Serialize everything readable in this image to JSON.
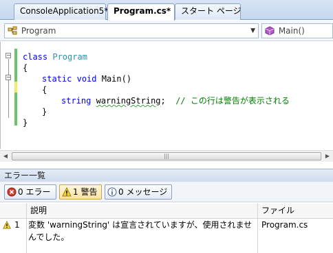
{
  "tabs": [
    {
      "label": "ConsoleApplication5*"
    },
    {
      "label": "Program.cs*"
    },
    {
      "label": "スタート ページ"
    }
  ],
  "nav": {
    "class_combo": "Program",
    "member_combo": "Main()"
  },
  "code": {
    "line1_kw": "class",
    "line1_type": "Program",
    "line2": "{",
    "line3_static": "static",
    "line3_void": "void",
    "line3_name": "Main()",
    "line4": "{",
    "line5_type": "string",
    "line5_var": "warningString",
    "line5_semi": ";",
    "line5_comment": "// この行は警告が表示される",
    "line6": "}",
    "line7": "}"
  },
  "error_list": {
    "title": "エラー一覧",
    "errors_label": "0 エラー",
    "warnings_label": "1 警告",
    "messages_label": "0 メッセージ",
    "columns": {
      "description": "説明",
      "file": "ファイル"
    },
    "rows": [
      {
        "index": "1",
        "description_line1": "変数 'warningString' は宣言されていますが、使用されませ",
        "description_line2": "んでした。",
        "file": "Program.cs"
      }
    ]
  },
  "colors": {
    "keyword": "#0000ff",
    "type": "#2b91af",
    "comment": "#008000",
    "change_bar_saved": "#6cc36c",
    "change_bar_unsaved": "#f4ea6b"
  }
}
